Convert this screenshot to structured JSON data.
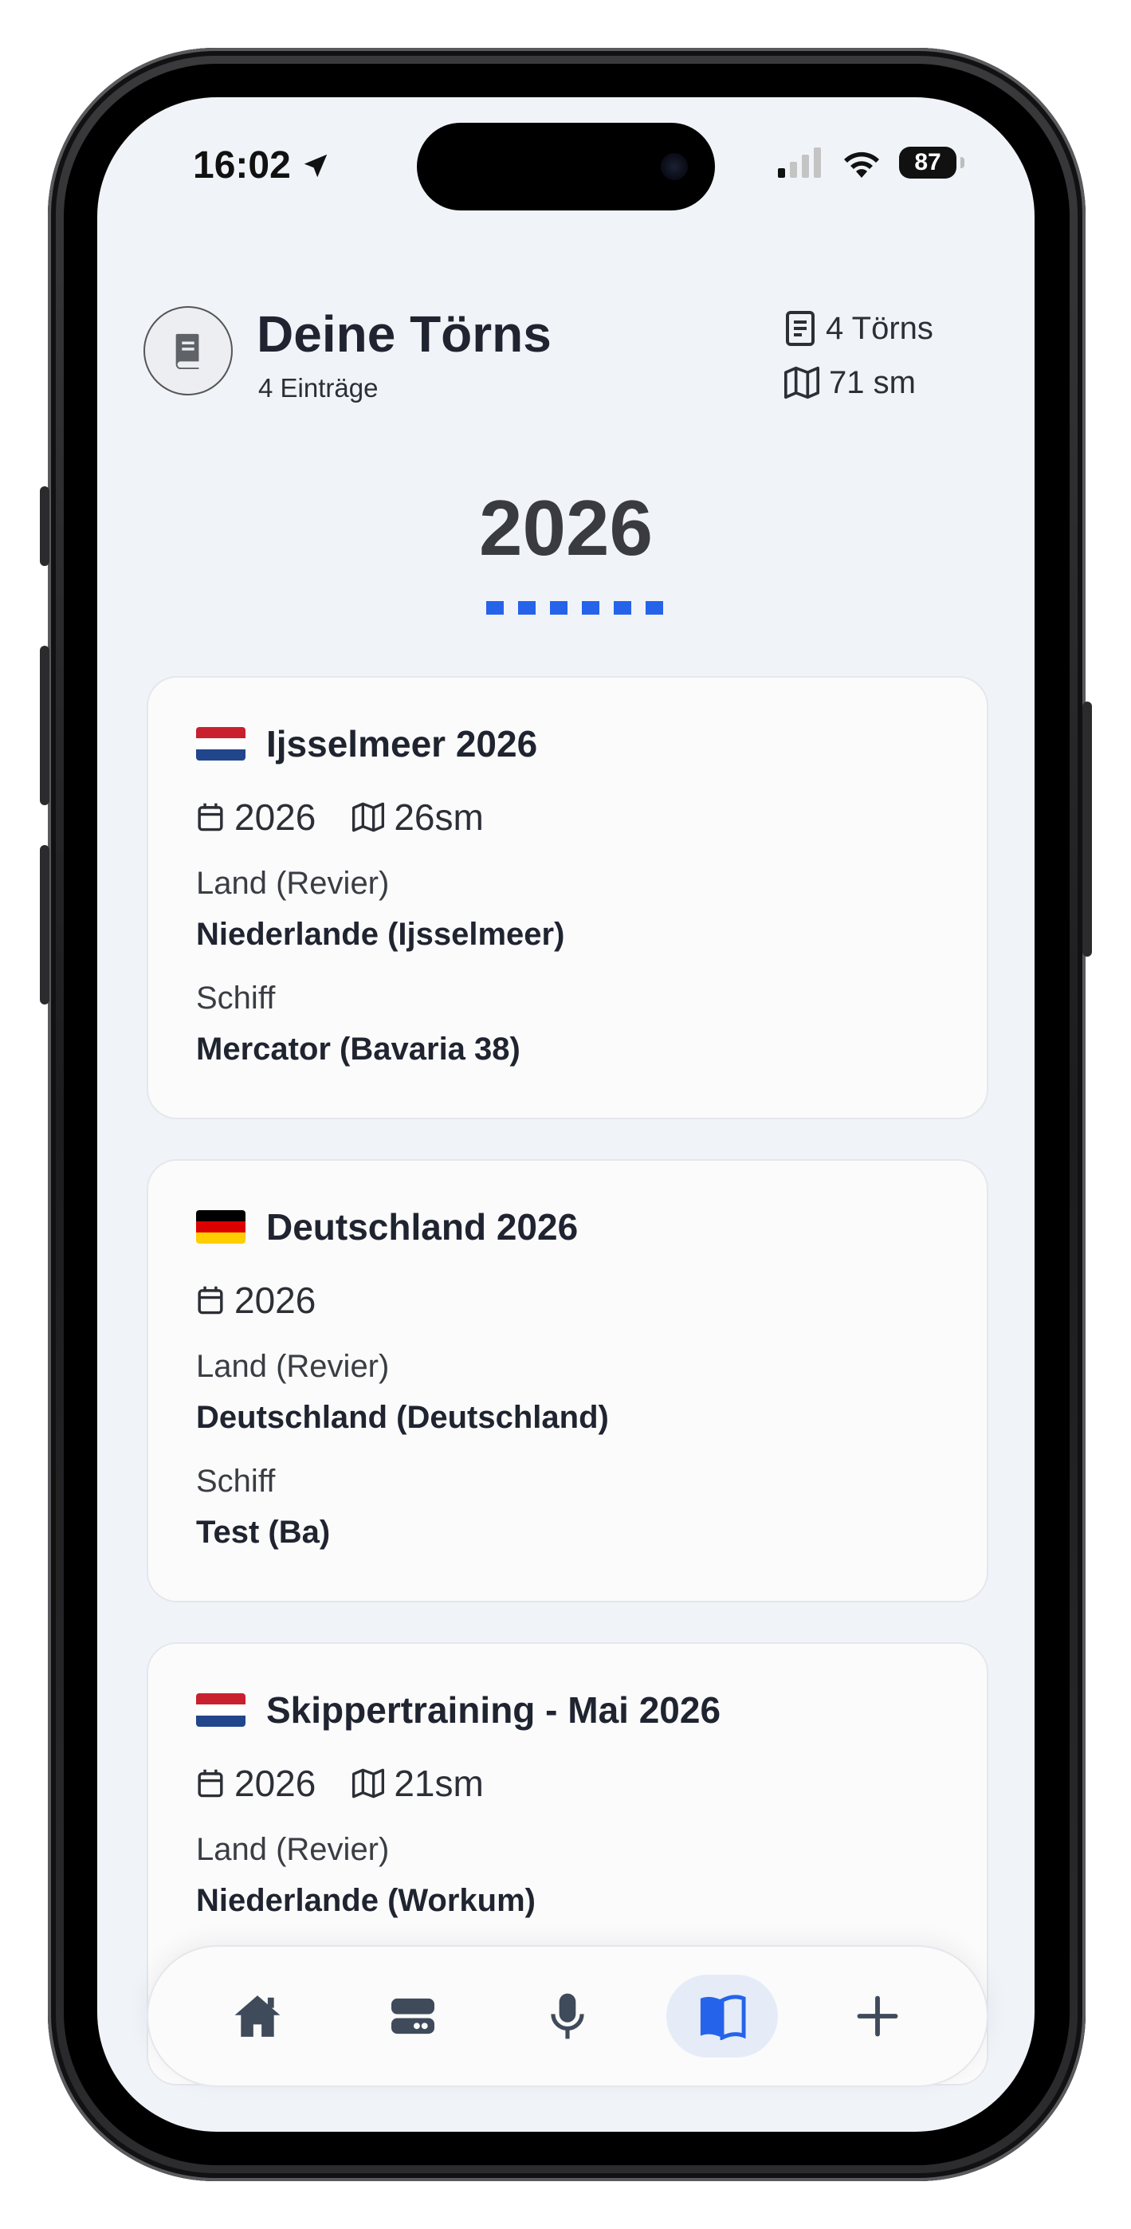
{
  "status_bar": {
    "time": "16:02",
    "battery": "87"
  },
  "header": {
    "title": "Deine Törns",
    "subtitle": "4 Einträge",
    "stat_trips": "4 Törns",
    "stat_distance": "71 sm"
  },
  "year_section": {
    "year": "2026"
  },
  "cards": [
    {
      "title": "Ijsselmeer 2026",
      "flag": "netherlands",
      "year": "2026",
      "distance": "26sm",
      "country_label": "Land (Revier)",
      "country_value": "Niederlande (Ijsselmeer)",
      "ship_label": "Schiff",
      "ship_value": "Mercator (Bavaria 38)"
    },
    {
      "title": "Deutschland 2026",
      "flag": "germany",
      "year": "2026",
      "country_label": "Land (Revier)",
      "country_value": "Deutschland (Deutschland)",
      "ship_label": "Schiff",
      "ship_value": "Test (Ba)"
    },
    {
      "title": "Skippertraining - Mai 2026",
      "flag": "netherlands",
      "year": "2026",
      "distance": "21sm",
      "country_label": "Land (Revier)",
      "country_value": "Niederlande (Workum)"
    }
  ],
  "nav": {
    "items": [
      "home-icon",
      "dashboard-icon",
      "microphone-icon",
      "logbook-icon",
      "add-icon"
    ],
    "active": "logbook-icon"
  },
  "colors": {
    "accent": "#2563eb",
    "background": "#f0f3f8",
    "text": "#1f2430"
  }
}
